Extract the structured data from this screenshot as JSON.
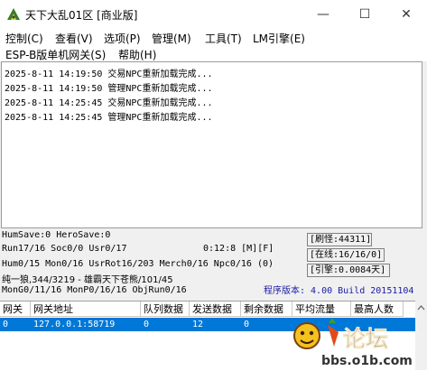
{
  "window": {
    "title": "天下大乱01区 [商业版]",
    "min_glyph": "—",
    "max_glyph": "☐",
    "close_glyph": "✕"
  },
  "menu_row1": [
    "控制(C)",
    "查看(V)",
    "选项(P)",
    "管理(M)",
    "工具(T)",
    "LM引擎(E)"
  ],
  "menu_row2": [
    "ESP-B版单机网关(S)",
    "帮助(H)"
  ],
  "log": [
    "2025-8-11 14:19:50 交易NPC重新加载完成...",
    "2025-8-11 14:19:50 管理NPC重新加载完成...",
    "2025-8-11 14:25:45 交易NPC重新加载完成...",
    "2025-8-11 14:25:45 管理NPC重新加载完成..."
  ],
  "status": {
    "humsave": "HumSave:0 HeroSave:0",
    "run": "Run17/16 Soc0/0 Usr0/17",
    "time": "0:12:8 [M][F]",
    "hum": "Hum0/15 Mon0/16 UsrRot16/203 Merch0/16 Npc0/16 (0)",
    "players": "纯一狼,344/3219 - 雄霸天下苍熊/101/45",
    "mon": "MonG0/11/16 MonP0/16/16 ObjRun0/16",
    "refresh": "[刷怪:44311]",
    "online": "[在线:16/16/0]",
    "engine": "[引擎:0.0084天]",
    "version": "程序版本: 4.00 Build 20151104"
  },
  "table": {
    "columns": [
      "网关",
      "网关地址",
      "队列数据",
      "发送数据",
      "剩余数据",
      "平均流量",
      "最高人数"
    ],
    "rows": [
      [
        "0",
        "127.0.0.1:58719",
        "0",
        "12",
        "0",
        "",
        ""
      ]
    ]
  },
  "watermark": {
    "brand": "论坛",
    "url": "bbs.o1b.com"
  },
  "colors": {
    "selection": "#0078d7",
    "version_text": "#1a1aa6"
  }
}
